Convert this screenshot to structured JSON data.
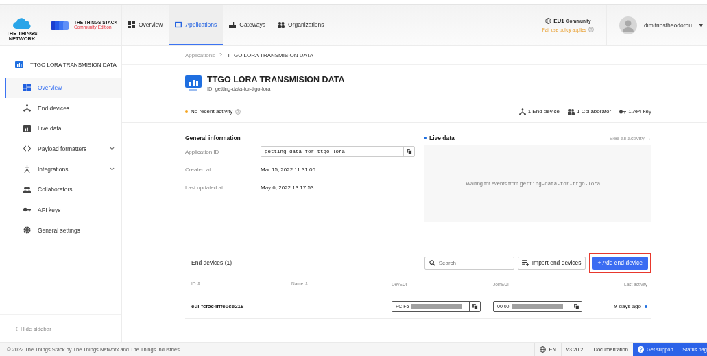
{
  "header": {
    "network_logo": "THE THINGS NETWORK",
    "product_name": "THE THINGS STACK",
    "product_edition": "Community Edition",
    "nav": [
      {
        "label": "Overview",
        "kind": "grid",
        "selected": false
      },
      {
        "label": "Applications",
        "kind": "window",
        "selected": true
      },
      {
        "label": "Gateways",
        "kind": "gateway",
        "selected": false
      },
      {
        "label": "Organizations",
        "kind": "people",
        "selected": false
      }
    ],
    "cluster": "EU1",
    "cluster_type": "Community",
    "policy": "Fair use policy applies",
    "username": "dimitriostheodorou"
  },
  "sidebar": {
    "app_name": "TTGO LORA TRANSMISION DATA",
    "items": [
      {
        "label": "Overview",
        "kind": "grid",
        "selected": true,
        "expandable": false
      },
      {
        "label": "End devices",
        "kind": "nodes",
        "selected": false,
        "expandable": false
      },
      {
        "label": "Live data",
        "kind": "chart",
        "selected": false,
        "expandable": false
      },
      {
        "label": "Payload formatters",
        "kind": "code",
        "selected": false,
        "expandable": true
      },
      {
        "label": "Integrations",
        "kind": "merge",
        "selected": false,
        "expandable": true
      },
      {
        "label": "Collaborators",
        "kind": "people",
        "selected": false,
        "expandable": false
      },
      {
        "label": "API keys",
        "kind": "key",
        "selected": false,
        "expandable": false
      },
      {
        "label": "General settings",
        "kind": "gear",
        "selected": false,
        "expandable": false
      }
    ],
    "hide_label": "Hide sidebar"
  },
  "breadcrumb": [
    "Applications",
    "TTGO LORA TRANSMISION DATA"
  ],
  "app": {
    "title": "TTGO LORA TRANSMISION DATA",
    "id_line": "ID: getting-data-for-ttgo-lora",
    "activity": "No recent activity",
    "stats": [
      {
        "label": "1 End device",
        "kind": "nodes"
      },
      {
        "label": "1 Collaborator",
        "kind": "people"
      },
      {
        "label": "1 API key",
        "kind": "key"
      }
    ]
  },
  "general_information": {
    "title": "General information",
    "fields": [
      {
        "label": "Application ID",
        "value": "getting-data-for-ttgo-lora",
        "kind": "copy"
      },
      {
        "label": "Created at",
        "value": "Mar 15, 2022 11:31:06",
        "kind": "text"
      },
      {
        "label": "Last updated at",
        "value": "May 6, 2022 13:17:53",
        "kind": "text"
      }
    ]
  },
  "live_data": {
    "title": "Live data",
    "link": "See all activity →",
    "waiting": "Waiting for events from",
    "source": "getting-data-for-ttgo-lora..."
  },
  "end_devices": {
    "title": "End devices (1)",
    "search": {
      "placeholder": "Search"
    },
    "import_label": "Import end devices",
    "add_button": {
      "label": "+ Add end device",
      "highlighted": true
    },
    "columns": [
      {
        "label": "ID ⇕"
      },
      {
        "label": "Name ⇕"
      },
      {
        "label": "DevEUI"
      },
      {
        "label": "JoinEUI"
      },
      {
        "label": "Last activity"
      }
    ],
    "rows": [
      {
        "id": "eui-fcf5c4fffe0ce218",
        "dev_eui": "FC F5",
        "join_eui": "00 00",
        "last_activity": "9 days ago"
      }
    ]
  },
  "footer": {
    "copyright": "© 2022 The Things Stack by The Things Network and The Things Industries",
    "language": "EN",
    "version": "v3.20.2",
    "documentation": "Documentation",
    "support": "Get support",
    "status": "Status pag"
  }
}
